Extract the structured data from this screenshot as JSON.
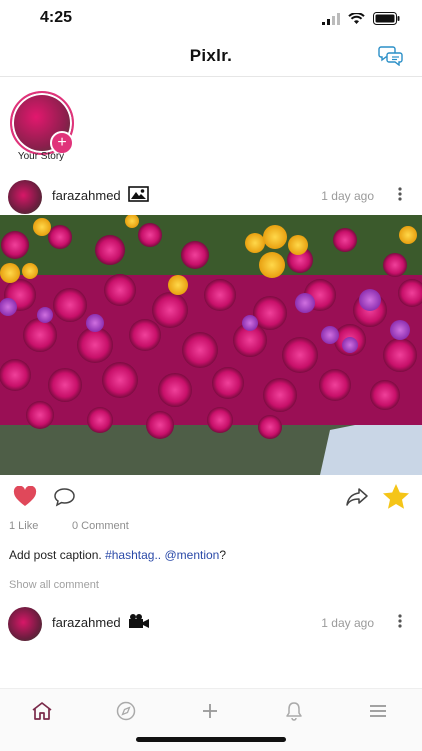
{
  "status": {
    "time": "4:25"
  },
  "app": {
    "title": "Pixlr."
  },
  "story": {
    "label": "Your Story",
    "plus": "+"
  },
  "posts": [
    {
      "username": "farazahmed",
      "date": "1 day ago",
      "media_icon": "image-icon"
    },
    {
      "username": "farazahmed",
      "date": "1 day ago",
      "media_icon": "video-camera-icon"
    }
  ],
  "post_stats": {
    "likes": "1 Like",
    "comments": "0 Comment"
  },
  "caption": {
    "text": "Add post caption. ",
    "hashtag": "#hashtag..",
    "mention": "@mention",
    "suffix": "?"
  },
  "show_all_comments": "Show all comment",
  "tabs": [
    "home-icon",
    "explore-compass-icon",
    "add-icon",
    "notifications-bell-icon",
    "menu-icon"
  ],
  "colors": {
    "accent": "#e0337a",
    "like": "#e0485a",
    "star": "#f5c518",
    "link": "#2b4aa8"
  }
}
